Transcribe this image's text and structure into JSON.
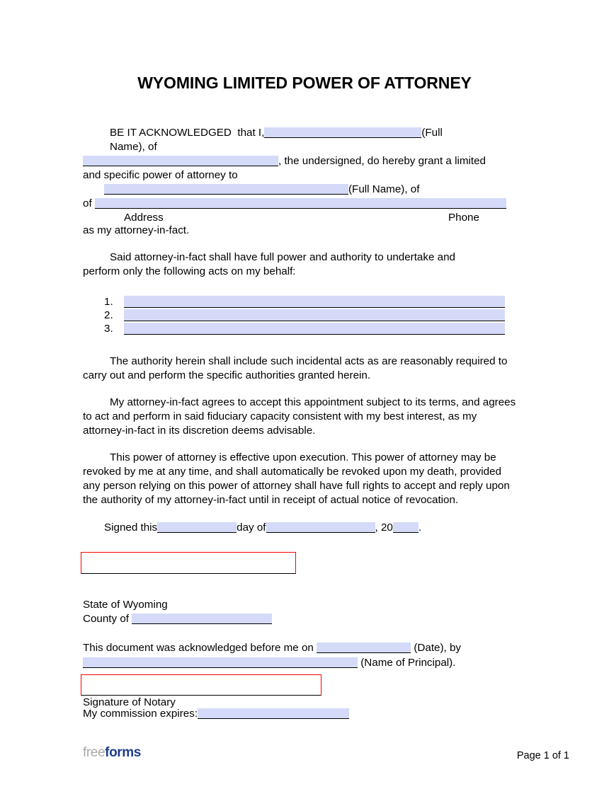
{
  "document": {
    "title": "WYOMING LIMITED POWER OF ATTORNEY"
  },
  "acknowledgement": {
    "lead": "BE IT ACKNOWLEDGED",
    "that_i": "that I,",
    "full_name_label": "(Full",
    "name_of": "Name), of",
    "undersigned_text": ", the undersigned, do hereby grant a limited",
    "grant_line": "and specific power of attorney to",
    "agent_full_name_label": "(Full Name), of",
    "of_prefix": "of",
    "address_label": "Address",
    "phone_label": "Phone",
    "attorney_in_fact_line": "as my attorney-in-fact.",
    "principal_name_value": "",
    "principal_address_value": "",
    "agent_name_value": "",
    "agent_address_value": ""
  },
  "powers": {
    "intro_line_1": "Said attorney-in-fact shall have full power and authority to undertake and",
    "intro_line_2": "perform only the following acts on my behalf:",
    "items": [
      {
        "number": "1.",
        "value": ""
      },
      {
        "number": "2.",
        "value": ""
      },
      {
        "number": "3.",
        "value": ""
      }
    ]
  },
  "paragraphs": {
    "incidental": "The authority herein shall include such incidental acts as are reasonably required to carry out and perform the specific authorities granted herein.",
    "acceptance": "My attorney-in-fact agrees to accept this appointment subject to its terms, and agrees to act and perform in said fiduciary capacity consistent with my best interest, as my attorney-in-fact in its discretion deems advisable.",
    "effective": "This power of attorney is effective upon execution. This power of attorney may be revoked by me at any time, and shall automatically be revoked upon my death, provided any person relying on this power of attorney shall have full rights to accept and reply upon the authority of my attorney-in-fact until in receipt of actual notice of revocation."
  },
  "signing": {
    "signed_this": "Signed this",
    "day_of": "day of",
    "comma_twenty": ", 20",
    "period": ".",
    "day_value": "",
    "month_value": "",
    "year_value": ""
  },
  "notary": {
    "state_line": "State of Wyoming",
    "county_label": "County of",
    "county_value": "",
    "ack_prefix": "This document was acknowledged before me on",
    "date_label": "(Date), by",
    "date_value": "",
    "principal_name_label": "(Name of Principal).",
    "principal_name_value": "",
    "signature_label": "Signature of Notary",
    "commission_label": "My commission expires:",
    "commission_value": ""
  },
  "footer": {
    "logo_first": "free",
    "logo_second": "forms",
    "page_indicator": "Page 1 of 1"
  },
  "colors": {
    "field_fill": "#d4daf8",
    "signature_box_border": "#ff0000",
    "logo_gray": "#a9a9a9",
    "logo_blue": "#1d3c8e",
    "text": "#000000"
  }
}
